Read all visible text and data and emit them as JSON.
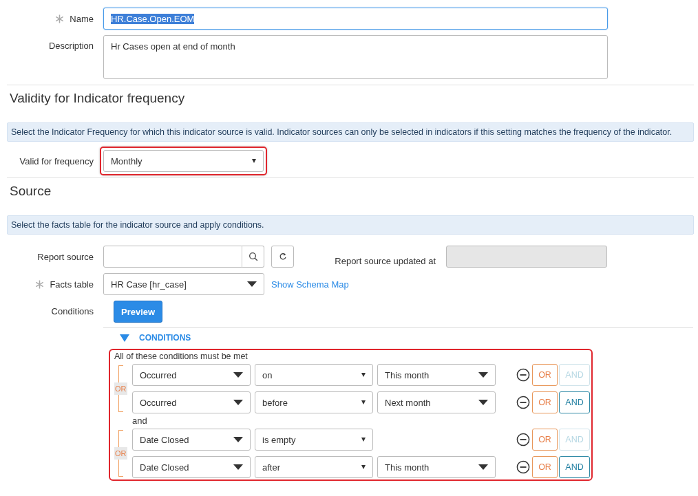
{
  "name_field": {
    "label": "Name",
    "required": true,
    "value": "HR.Case.Open.EOM",
    "text_selected": true
  },
  "description_field": {
    "label": "Description",
    "value": "Hr Cases open at end of month"
  },
  "validity_section": {
    "heading": "Validity for Indicator frequency",
    "info": "Select the Indicator Frequency for which this indicator source is valid. Indicator sources can only be selected in indicators if this setting matches the frequency of the indicator.",
    "frequency": {
      "label": "Valid for frequency",
      "value": "Monthly",
      "highlighted": true
    }
  },
  "source_section": {
    "heading": "Source",
    "info": "Select the facts table for the indicator source and apply conditions.",
    "report_source": {
      "label": "Report source"
    },
    "report_source_updated": {
      "label": "Report source updated at",
      "disabled": true
    },
    "facts_table": {
      "label": "Facts table",
      "required": true,
      "value": "HR Case [hr_case]",
      "link": "Show Schema Map"
    },
    "conditions": {
      "label": "Conditions",
      "preview_button": "Preview",
      "header": "CONDITIONS",
      "expanded": true,
      "highlighted": true,
      "intro": "All of these conditions must be met",
      "groups": [
        {
          "or_tag": "OR",
          "rows": [
            {
              "field": "Occurred",
              "operator": "on",
              "value": "This month",
              "or_button": "OR",
              "and_button": "AND",
              "and_disabled": true
            },
            {
              "field": "Occurred",
              "operator": "before",
              "value": "Next month",
              "or_button": "OR",
              "and_button": "AND",
              "and_disabled": false
            }
          ]
        },
        {
          "joiner": "and",
          "or_tag": "OR",
          "rows": [
            {
              "field": "Date Closed",
              "operator": "is empty",
              "or_button": "OR",
              "and_button": "AND",
              "and_disabled": true
            },
            {
              "field": "Date Closed",
              "operator": "after",
              "value": "This month",
              "or_button": "OR",
              "and_button": "AND",
              "and_disabled": false
            }
          ]
        }
      ]
    }
  }
}
